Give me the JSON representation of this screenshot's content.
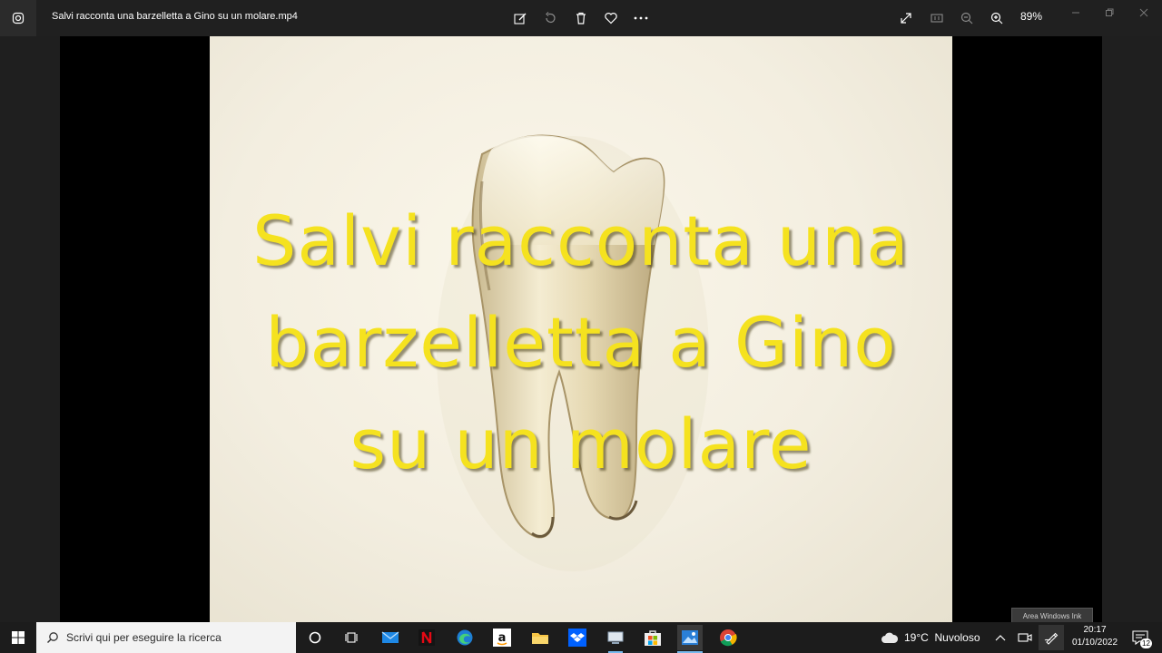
{
  "titlebar": {
    "title": "Salvi racconta una barzelletta a Gino su un molare.mp4",
    "zoom": "89%",
    "icons": [
      "app-icon",
      "edit-icon",
      "rotate-icon",
      "delete-icon",
      "favorite-icon",
      "more-icon",
      "fullscreen-icon",
      "actual-size-icon",
      "zoom-out-icon",
      "zoom-in-icon",
      "minimize-icon",
      "maximize-icon",
      "close-icon"
    ]
  },
  "video": {
    "caption_lines": [
      "Salvi racconta una",
      "barzelletta a Gino",
      "su un molare"
    ],
    "caption_color": "#f5e21f",
    "background_color": "#f6f2e6"
  },
  "tooltip": {
    "text": "Area Windows Ink"
  },
  "taskbar": {
    "search_placeholder": "Scrivi qui per eseguire la ricerca",
    "apps": [
      "cortana",
      "task-view",
      "mail",
      "netflix",
      "edge",
      "amazon",
      "file-explorer",
      "dropbox",
      "devices",
      "store",
      "photos",
      "chrome"
    ],
    "weather": {
      "temp": "19°C",
      "condition": "Nuvoloso"
    },
    "time": "20:17",
    "date": "01/10/2022",
    "notifications": "12"
  }
}
